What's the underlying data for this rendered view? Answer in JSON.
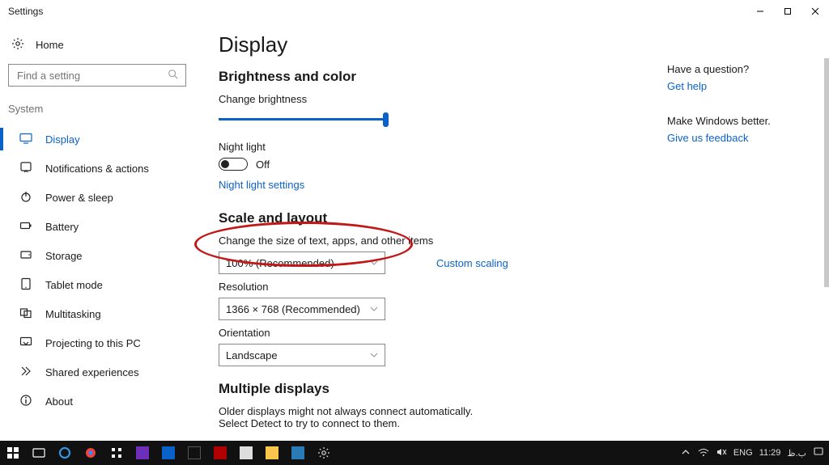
{
  "window": {
    "title": "Settings"
  },
  "sidebar": {
    "home": "Home",
    "search_placeholder": "Find a setting",
    "category": "System",
    "items": [
      {
        "id": "display",
        "label": "Display",
        "active": true
      },
      {
        "id": "notif",
        "label": "Notifications & actions",
        "active": false
      },
      {
        "id": "power",
        "label": "Power & sleep",
        "active": false
      },
      {
        "id": "battery",
        "label": "Battery",
        "active": false
      },
      {
        "id": "storage",
        "label": "Storage",
        "active": false
      },
      {
        "id": "tablet",
        "label": "Tablet mode",
        "active": false
      },
      {
        "id": "multitask",
        "label": "Multitasking",
        "active": false
      },
      {
        "id": "project",
        "label": "Projecting to this PC",
        "active": false
      },
      {
        "id": "shared",
        "label": "Shared experiences",
        "active": false
      },
      {
        "id": "about",
        "label": "About",
        "active": false
      }
    ]
  },
  "main": {
    "title": "Display",
    "brightness_section": "Brightness and color",
    "brightness_label": "Change brightness",
    "brightness_value_pct": 100,
    "night_light_label": "Night light",
    "night_light_state": "Off",
    "night_light_settings_link": "Night light settings",
    "scale_section": "Scale and layout",
    "scale_label": "Change the size of text, apps, and other items",
    "scale_value": "100% (Recommended)",
    "custom_scaling_link": "Custom scaling",
    "resolution_label": "Resolution",
    "resolution_value": "1366 × 768 (Recommended)",
    "orientation_label": "Orientation",
    "orientation_value": "Landscape",
    "multiple_section": "Multiple displays",
    "multiple_desc": "Older displays might not always connect automatically. Select Detect to try to connect to them."
  },
  "right": {
    "q_header": "Have a question?",
    "help_link": "Get help",
    "better_header": "Make Windows better.",
    "feedback_link": "Give us feedback"
  },
  "taskbar": {
    "lang": "ENG",
    "time": "11:29",
    "date_label": "ب.ظ"
  },
  "colors": {
    "accent": "#0a62c9",
    "highlight_ring": "#c21717"
  }
}
